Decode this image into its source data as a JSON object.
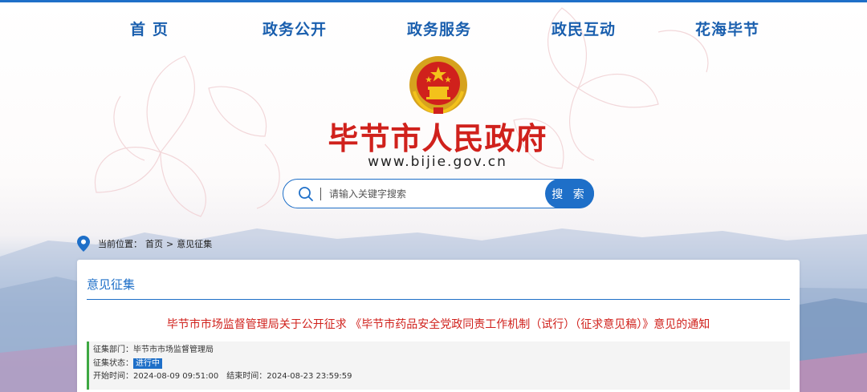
{
  "nav": {
    "items": [
      "首页",
      "政务公开",
      "政务服务",
      "政民互动",
      "花海毕节"
    ]
  },
  "site": {
    "title": "毕节市人民政府",
    "url": "www.bijie.gov.cn"
  },
  "search": {
    "placeholder": "请输入关键字搜索",
    "button_label": "搜 索"
  },
  "breadcrumb": {
    "prefix": "当前位置：",
    "items": [
      "首页",
      ">",
      "意见征集"
    ]
  },
  "panel": {
    "title": "意见征集",
    "notice_title": "毕节市市场监督管理局关于公开征求 《毕节市药品安全党政同责工作机制（试行）（征求意见稿）》意见的通知",
    "dept_label": "征集部门：",
    "dept_value": "毕节市市场监督管理局",
    "status_label": "征集状态：",
    "status_value": "进行中",
    "start_label": "开始时间：",
    "start_value": "2024-08-09 09:51:00",
    "end_label": "结束时间：",
    "end_value": "2024-08-23 23:59:59"
  },
  "colors": {
    "accent": "#1e6fc8",
    "title_red": "#d0211c",
    "status_green": "#3ea843"
  }
}
